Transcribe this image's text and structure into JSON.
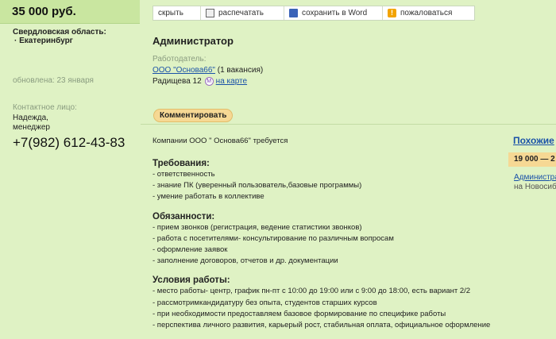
{
  "sidebar": {
    "salary": "35 000 руб.",
    "region": "Свердловская область:",
    "city": "· Екатеринбург",
    "updated": "обновлена: 23 января",
    "contact_label": "Контактное лицо:",
    "contact_name": "Надежда, менеджер",
    "phone": "+7(982) 612-43-83"
  },
  "toolbar": {
    "hide": "скрыть",
    "print": "распечатать",
    "save_word": "сохранить в Word",
    "complain": "пожаловаться"
  },
  "vacancy": {
    "title": "Администратор",
    "employer_label": "Работодатель:",
    "company": "ООО \"Основа66\"",
    "vacancy_count": "(1 вакансия)",
    "address": "Радищева 12",
    "metro_glyph": "М",
    "map_link": "на карте",
    "comment_button": "Комментировать"
  },
  "description": {
    "intro": "Компании ООО \" Основа66\" требуется",
    "sections": [
      {
        "title": "Требования:",
        "items": [
          "- ответственность",
          "- знание ПК (уверенный пользователь,базовые программы)",
          "- умение работать в коллективе"
        ]
      },
      {
        "title": "Обязанности:",
        "items": [
          "- прием звонков (регистрация, ведение статистики звонков)",
          "- работа с посетителями- консультирование по различным вопросам",
          "- оформление заявок",
          "- заполнение договоров, отчетов и др. документации"
        ]
      },
      {
        "title": "Условия работы:",
        "items": [
          "- место работы- центр, график пн-пт с 10:00 до 19:00 или с 9:00 до 18:00, есть вариант 2/2",
          "- рассмотримкандидатуру без опыта, студентов старших курсов",
          "- при необходимости предоставляем базовое формирование по специфике работы",
          "- перспектива личного развития, карьерый рост, стабильная оплата, официальное оформление"
        ]
      }
    ]
  },
  "similar": {
    "title": "Похожие",
    "salary": "19 000 — 2",
    "job": "Администра",
    "location": "на Новосиб"
  },
  "colors": {
    "background": "#dff2c4",
    "link": "#1a52a8",
    "highlight": "#f6d894"
  }
}
